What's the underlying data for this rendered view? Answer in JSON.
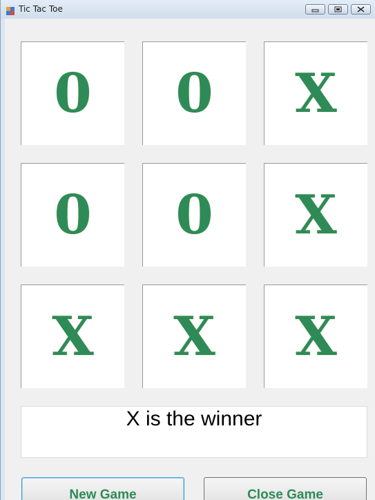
{
  "window": {
    "title": "Tic Tac Toe"
  },
  "board": {
    "cells": [
      "0",
      "0",
      "X",
      "0",
      "0",
      "X",
      "X",
      "X",
      "X"
    ]
  },
  "status": {
    "message": "X is the winner"
  },
  "buttons": {
    "new_game": "New Game",
    "close_game": "Close Game"
  },
  "colors": {
    "mark": "#2e8b57",
    "form_background": "#f0f0f0",
    "cell_background": "#ffffff",
    "focus_border": "#3c9ad6"
  }
}
